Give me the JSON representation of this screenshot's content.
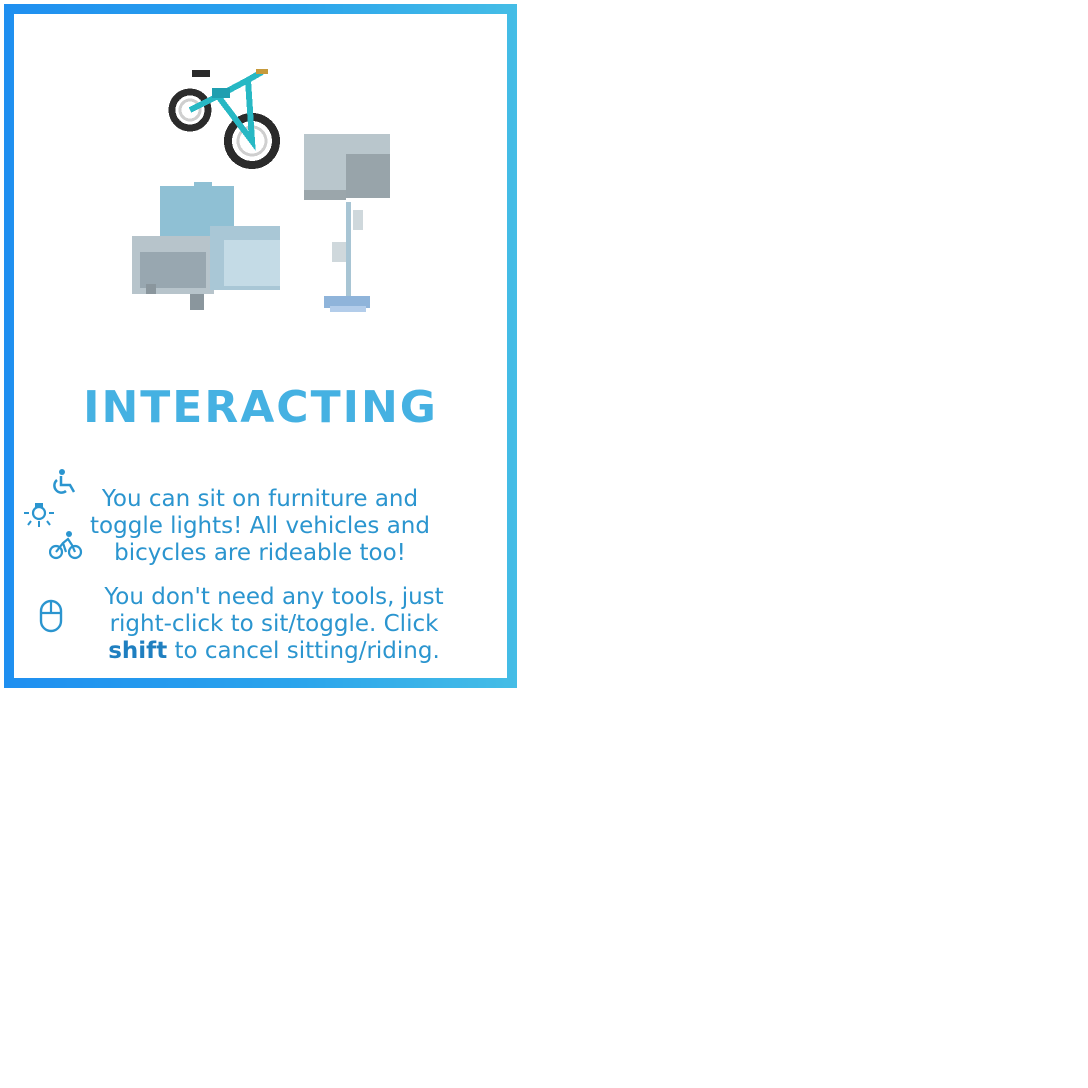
{
  "card": {
    "heading": "INTERACTING",
    "colors": {
      "frame_start": "#1f8ff0",
      "frame_end": "#45bde6",
      "heading": "#45b1e2",
      "text": "#2b95cf"
    },
    "illustration": {
      "items": [
        "bicycle-icon",
        "armchair-icon",
        "floor-lamp-icon"
      ]
    },
    "tips": [
      {
        "icons": [
          "wheelchair-icon",
          "lightbulb-icon",
          "cyclist-icon"
        ],
        "lines": [
          "You can sit on furniture and",
          "toggle lights! All vehicles and",
          "bicycles are rideable too!"
        ]
      },
      {
        "icons": [
          "mouse-icon"
        ],
        "line1": "You don't need any tools, just",
        "line2": "right-click to sit/toggle. Click",
        "line3_bold": "shift",
        "line3_rest": " to cancel sitting/riding."
      }
    ]
  }
}
